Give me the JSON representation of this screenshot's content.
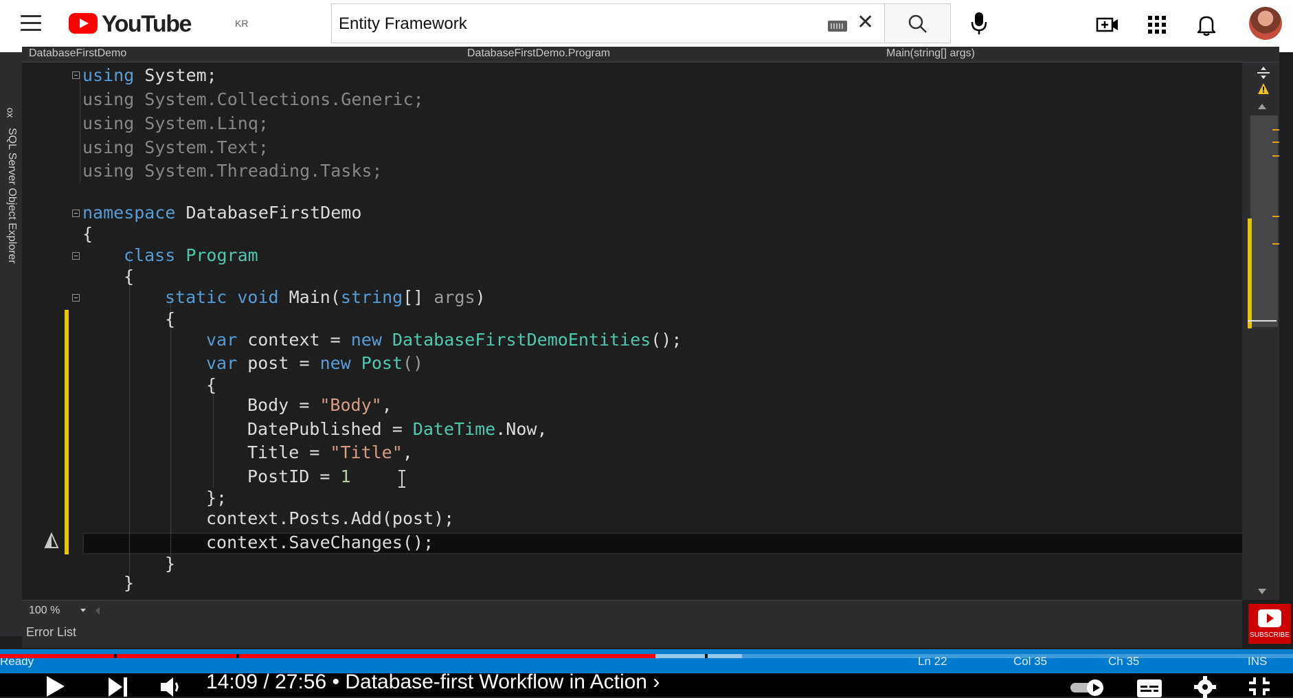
{
  "youtube": {
    "logo_text": "YouTube",
    "country_code": "KR",
    "search_value": "Entity Framework",
    "icons": [
      "menu-icon",
      "keyboard-icon",
      "clear-icon",
      "search-icon",
      "mic-icon",
      "create-video-icon",
      "apps-icon",
      "notifications-icon",
      "avatar"
    ]
  },
  "vs": {
    "side_panel_title": "SQL Server Object Explorer",
    "side_panel_cut": "ox",
    "nav": {
      "project": "DatabaseFirstDemo",
      "class": "DatabaseFirstDemo.Program",
      "member": "Main(string[] args)"
    },
    "code": {
      "l1_kw": "using",
      "l1_rest": " System;",
      "l2": "using System.Collections.Generic;",
      "l3": "using System.Linq;",
      "l4": "using System.Text;",
      "l5": "using System.Threading.Tasks;",
      "l6_kw": "namespace",
      "l6_rest": " DatabaseFirstDemo",
      "l7": "{",
      "l8_kw": "class",
      "l8_ty": " Program",
      "l9": "{",
      "l10_kw": "static void",
      "l10_a": " Main(",
      "l10_b": "string",
      "l10_c": "[] ",
      "l10_d": "args",
      "l10_e": ")",
      "l11": "{",
      "l12_kw": "var",
      "l12_a": " context = ",
      "l12_b": "new",
      "l12_c": " DatabaseFirstDemoEntities",
      "l12_d": "();",
      "l13_kw": "var",
      "l13_a": " post = ",
      "l13_b": "new",
      "l13_c": " Post",
      "l13_d": "()",
      "l14": "{",
      "l15_a": "Body = ",
      "l15_b": "\"Body\"",
      "l15_c": ",",
      "l16_a": "DatePublished = ",
      "l16_b": "DateTime",
      "l16_c": ".Now,",
      "l17_a": "Title = ",
      "l17_b": "\"Title\"",
      "l17_c": ",",
      "l18_a": "PostID = ",
      "l18_b": "1",
      "l19": "};",
      "l20": "context.Posts.Add(post);",
      "l21": "context.SaveChanges();",
      "l22": "}",
      "l23": "}"
    },
    "zoom": "100 %",
    "error_list": "Error List",
    "status": {
      "ready": "Ready",
      "ln": "Ln 22",
      "col": "Col 35",
      "ch": "Ch 35",
      "ins": "INS"
    }
  },
  "player": {
    "time_current": "14:09",
    "time_total": "27:56",
    "chapter": "Database-first Workflow in Action",
    "subscribe_label": "SUBSCRIBE",
    "progress_played_fraction": 0.507,
    "progress_loaded_fraction": 0.574
  }
}
